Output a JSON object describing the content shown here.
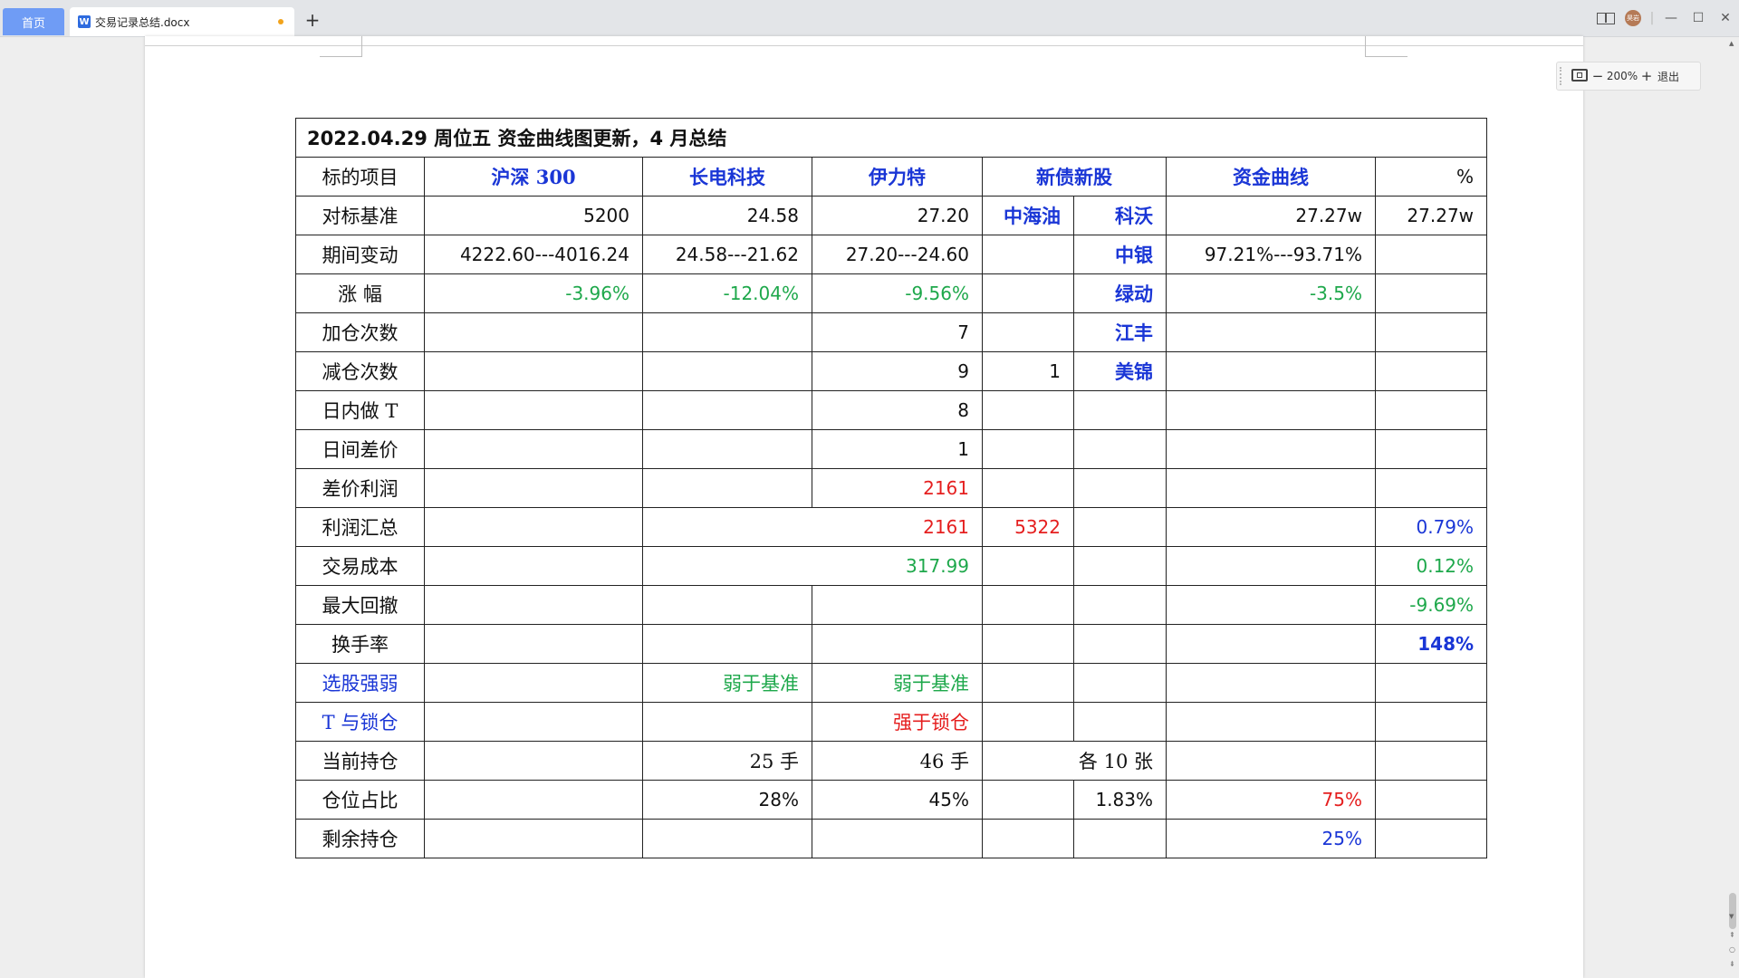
{
  "tabs": {
    "home": "首页",
    "doc_title": "交易记录总结.docx",
    "add": "+"
  },
  "window": {
    "avatar": "昊岩"
  },
  "zoom": {
    "level": "200%",
    "minus": "−",
    "plus": "+",
    "exit": "退出"
  },
  "table": {
    "title": "2022.04.29  周位五  资金曲线图更新，4 月总结",
    "headers": [
      "标的项目",
      "沪深 300",
      "长电科技",
      "伊力特",
      "新债新股",
      "资金曲线",
      "%"
    ],
    "bonds": [
      "中海油",
      "科沃",
      "中银",
      "绿动",
      "江丰",
      "美锦"
    ],
    "rows": {
      "benchmark": {
        "label": "对标基准",
        "hs300": "5200",
        "cdkj": "24.58",
        "ylt": "27.20",
        "curve": "27.27w",
        "pct": "27.27w"
      },
      "change": {
        "label": "期间变动",
        "hs300": "4222.60---4016.24",
        "cdkj": "24.58---21.62",
        "ylt": "27.20---24.60",
        "curve": "97.21%---93.71%"
      },
      "rise": {
        "label": "涨  幅",
        "hs300": "-3.96%",
        "cdkj": "-12.04%",
        "ylt": "-9.56%",
        "curve": "-3.5%"
      },
      "add_count": {
        "label": "加仓次数",
        "ylt": "7"
      },
      "reduce_count": {
        "label": "减仓次数",
        "ylt": "9",
        "bond": "1"
      },
      "intraday_t": {
        "label": "日内做 T",
        "ylt": "8"
      },
      "interday": {
        "label": "日间差价",
        "ylt": "1"
      },
      "spread_profit": {
        "label": "差价利润",
        "ylt": "2161"
      },
      "profit_total": {
        "label": "利润汇总",
        "ylt": "2161",
        "bond": "5322",
        "pct": "0.79%"
      },
      "cost": {
        "label": "交易成本",
        "ylt": "317.99",
        "pct": "0.12%"
      },
      "drawdown": {
        "label": "最大回撤",
        "pct": "-9.69%"
      },
      "turnover": {
        "label": "换手率",
        "pct": "148%"
      },
      "stock_pick": {
        "label": "选股强弱",
        "cdkj": "弱于基准",
        "ylt": "弱于基准"
      },
      "t_lock": {
        "label": "T 与锁仓",
        "ylt": "强于锁仓"
      },
      "holding": {
        "label": "当前持仓",
        "cdkj": "25 手",
        "ylt": "46 手",
        "bond": "各 10 张"
      },
      "position_ratio": {
        "label": "仓位占比",
        "cdkj": "28%",
        "ylt": "45%",
        "bond": "1.83%",
        "curve": "75%"
      },
      "remaining": {
        "label": "剩余持仓",
        "curve": "25%"
      }
    }
  }
}
